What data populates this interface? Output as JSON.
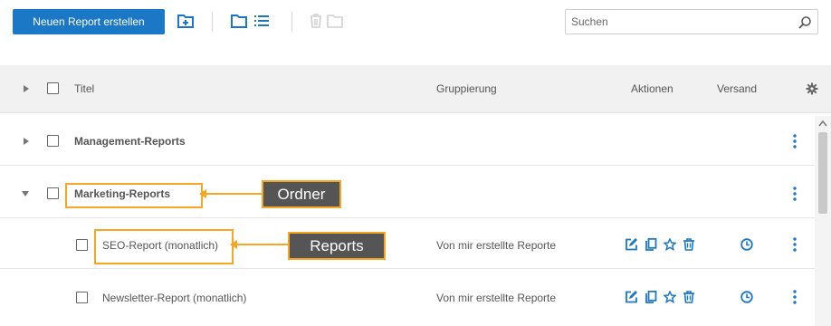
{
  "toolbar": {
    "new_report_label": "Neuen Report erstellen",
    "search_placeholder": "Suchen"
  },
  "table_header": {
    "title": "Titel",
    "grouping": "Gruppierung",
    "actions": "Aktionen",
    "dispatch": "Versand"
  },
  "rows": [
    {
      "type": "folder",
      "title": "Management-Reports",
      "expanded": false
    },
    {
      "type": "folder",
      "title": "Marketing-Reports",
      "expanded": true
    },
    {
      "type": "report",
      "title": "SEO-Report (monatlich)",
      "grouping": "Von mir erstellte Reporte"
    },
    {
      "type": "report",
      "title": "Newsletter-Report (monatlich)",
      "grouping": "Von mir erstellte Reporte"
    }
  ],
  "callouts": {
    "folder_label": "Ordner",
    "reports_label": "Reports"
  },
  "colors": {
    "primary": "#1b78c6",
    "callout_border": "#f5a623",
    "callout_fill": "#555555"
  }
}
